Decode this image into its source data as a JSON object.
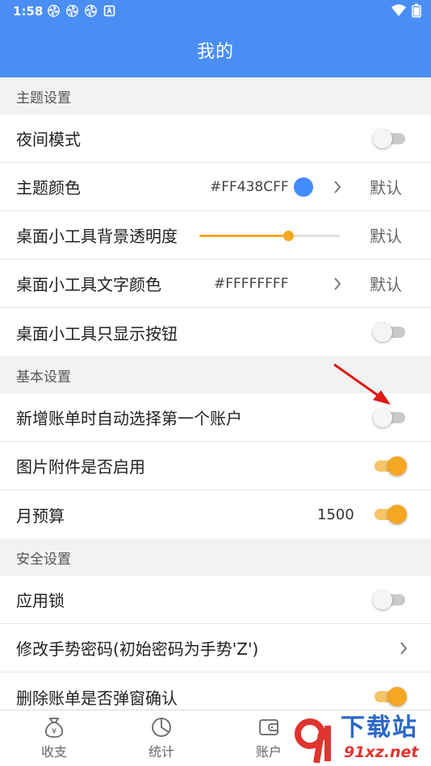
{
  "status_bar": {
    "time": "1:58",
    "notification_icons": [
      "pinwheel-icon",
      "pinwheel-icon",
      "pinwheel-icon",
      "a-icon"
    ],
    "right_icons": [
      "wifi-icon",
      "battery-icon"
    ]
  },
  "header": {
    "title": "我的",
    "background": "#4a8ef5"
  },
  "sections": {
    "theme": {
      "title": "主题设置",
      "night_mode": {
        "label": "夜间模式",
        "on": false
      },
      "theme_color": {
        "label": "主题颜色",
        "value": "#FF438CFF",
        "swatch": "#438CFF",
        "default_label": "默认"
      },
      "widget_bg_opacity": {
        "label": "桌面小工具背景透明度",
        "level": 0.63,
        "default_label": "默认"
      },
      "widget_text_color": {
        "label": "桌面小工具文字颜色",
        "value": "#FFFFFFFF",
        "default_label": "默认"
      },
      "widget_buttons_only": {
        "label": "桌面小工具只显示按钮",
        "on": false
      }
    },
    "basic": {
      "title": "基本设置",
      "auto_select_account": {
        "label": "新增账单时自动选择第一个账户",
        "on": false
      },
      "image_attachment": {
        "label": "图片附件是否启用",
        "on": true
      },
      "monthly_budget": {
        "label": "月预算",
        "value": "1500",
        "on": true
      }
    },
    "security": {
      "title": "安全设置",
      "app_lock": {
        "label": "应用锁",
        "on": false
      },
      "change_gesture": {
        "label": "修改手势密码(初始密码为手势'Z')"
      },
      "delete_confirm": {
        "label": "删除账单是否弹窗确认",
        "on": true
      }
    }
  },
  "bottom_nav": [
    {
      "label": "收支",
      "icon": "money-bag-icon"
    },
    {
      "label": "统计",
      "icon": "pie-chart-icon"
    },
    {
      "label": "账户",
      "icon": "wallet-icon"
    }
  ],
  "watermark": {
    "brand": "下载站",
    "url": "91xz.net"
  },
  "colors": {
    "accent": "#4a8ef5",
    "toggle_on": "#f5a623",
    "arrow": "#e01818"
  }
}
